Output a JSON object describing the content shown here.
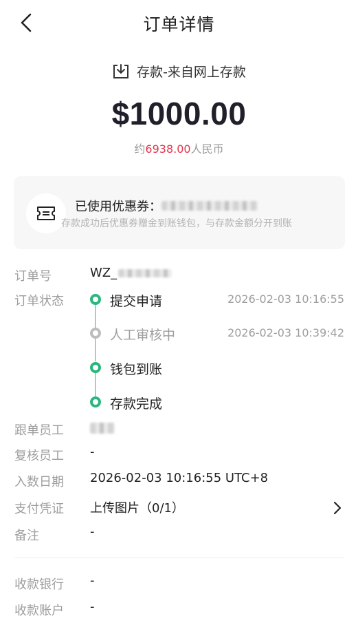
{
  "header": {
    "title": "订单详情",
    "back_icon": "chevron-left-icon"
  },
  "summary": {
    "type_label": "存款-来自网上存款",
    "type_icon": "download-tray-icon",
    "amount": "$1000.00",
    "cny_prefix": "约",
    "cny_value": "6938.00",
    "cny_suffix": "人民币",
    "cny_color": "#e5344b"
  },
  "coupon": {
    "icon": "ticket-icon",
    "title": "已使用优惠券：",
    "description": "存款成功后优惠券赠金到账钱包，与存款金额分开到账"
  },
  "fields": {
    "order_no_label": "订单号",
    "order_no_value": "WZ_",
    "status_label": "订单状态",
    "follow_staff_label": "跟单员工",
    "review_staff_label": "复核员工",
    "review_staff_value": "-",
    "entry_date_label": "入数日期",
    "entry_date_value": "2026-02-03 10:16:55 UTC+8",
    "proof_label": "支付凭证",
    "proof_value": "上传图片（0/1）",
    "remark_label": "备注",
    "remark_value": "-",
    "bank_label": "收款银行",
    "bank_value": "-",
    "account_label": "收款账户",
    "account_value": "-"
  },
  "timeline": [
    {
      "label": "提交申请",
      "time": "2026-02-03 10:16:55",
      "state": "done"
    },
    {
      "label": "人工审核中",
      "time": "2026-02-03 10:39:42",
      "state": "pending"
    },
    {
      "label": "钱包到账",
      "time": "",
      "state": "done"
    },
    {
      "label": "存款完成",
      "time": "",
      "state": "done"
    }
  ],
  "colors": {
    "accent_green": "#2ab77f",
    "pending_gray": "#bdbdbd"
  }
}
